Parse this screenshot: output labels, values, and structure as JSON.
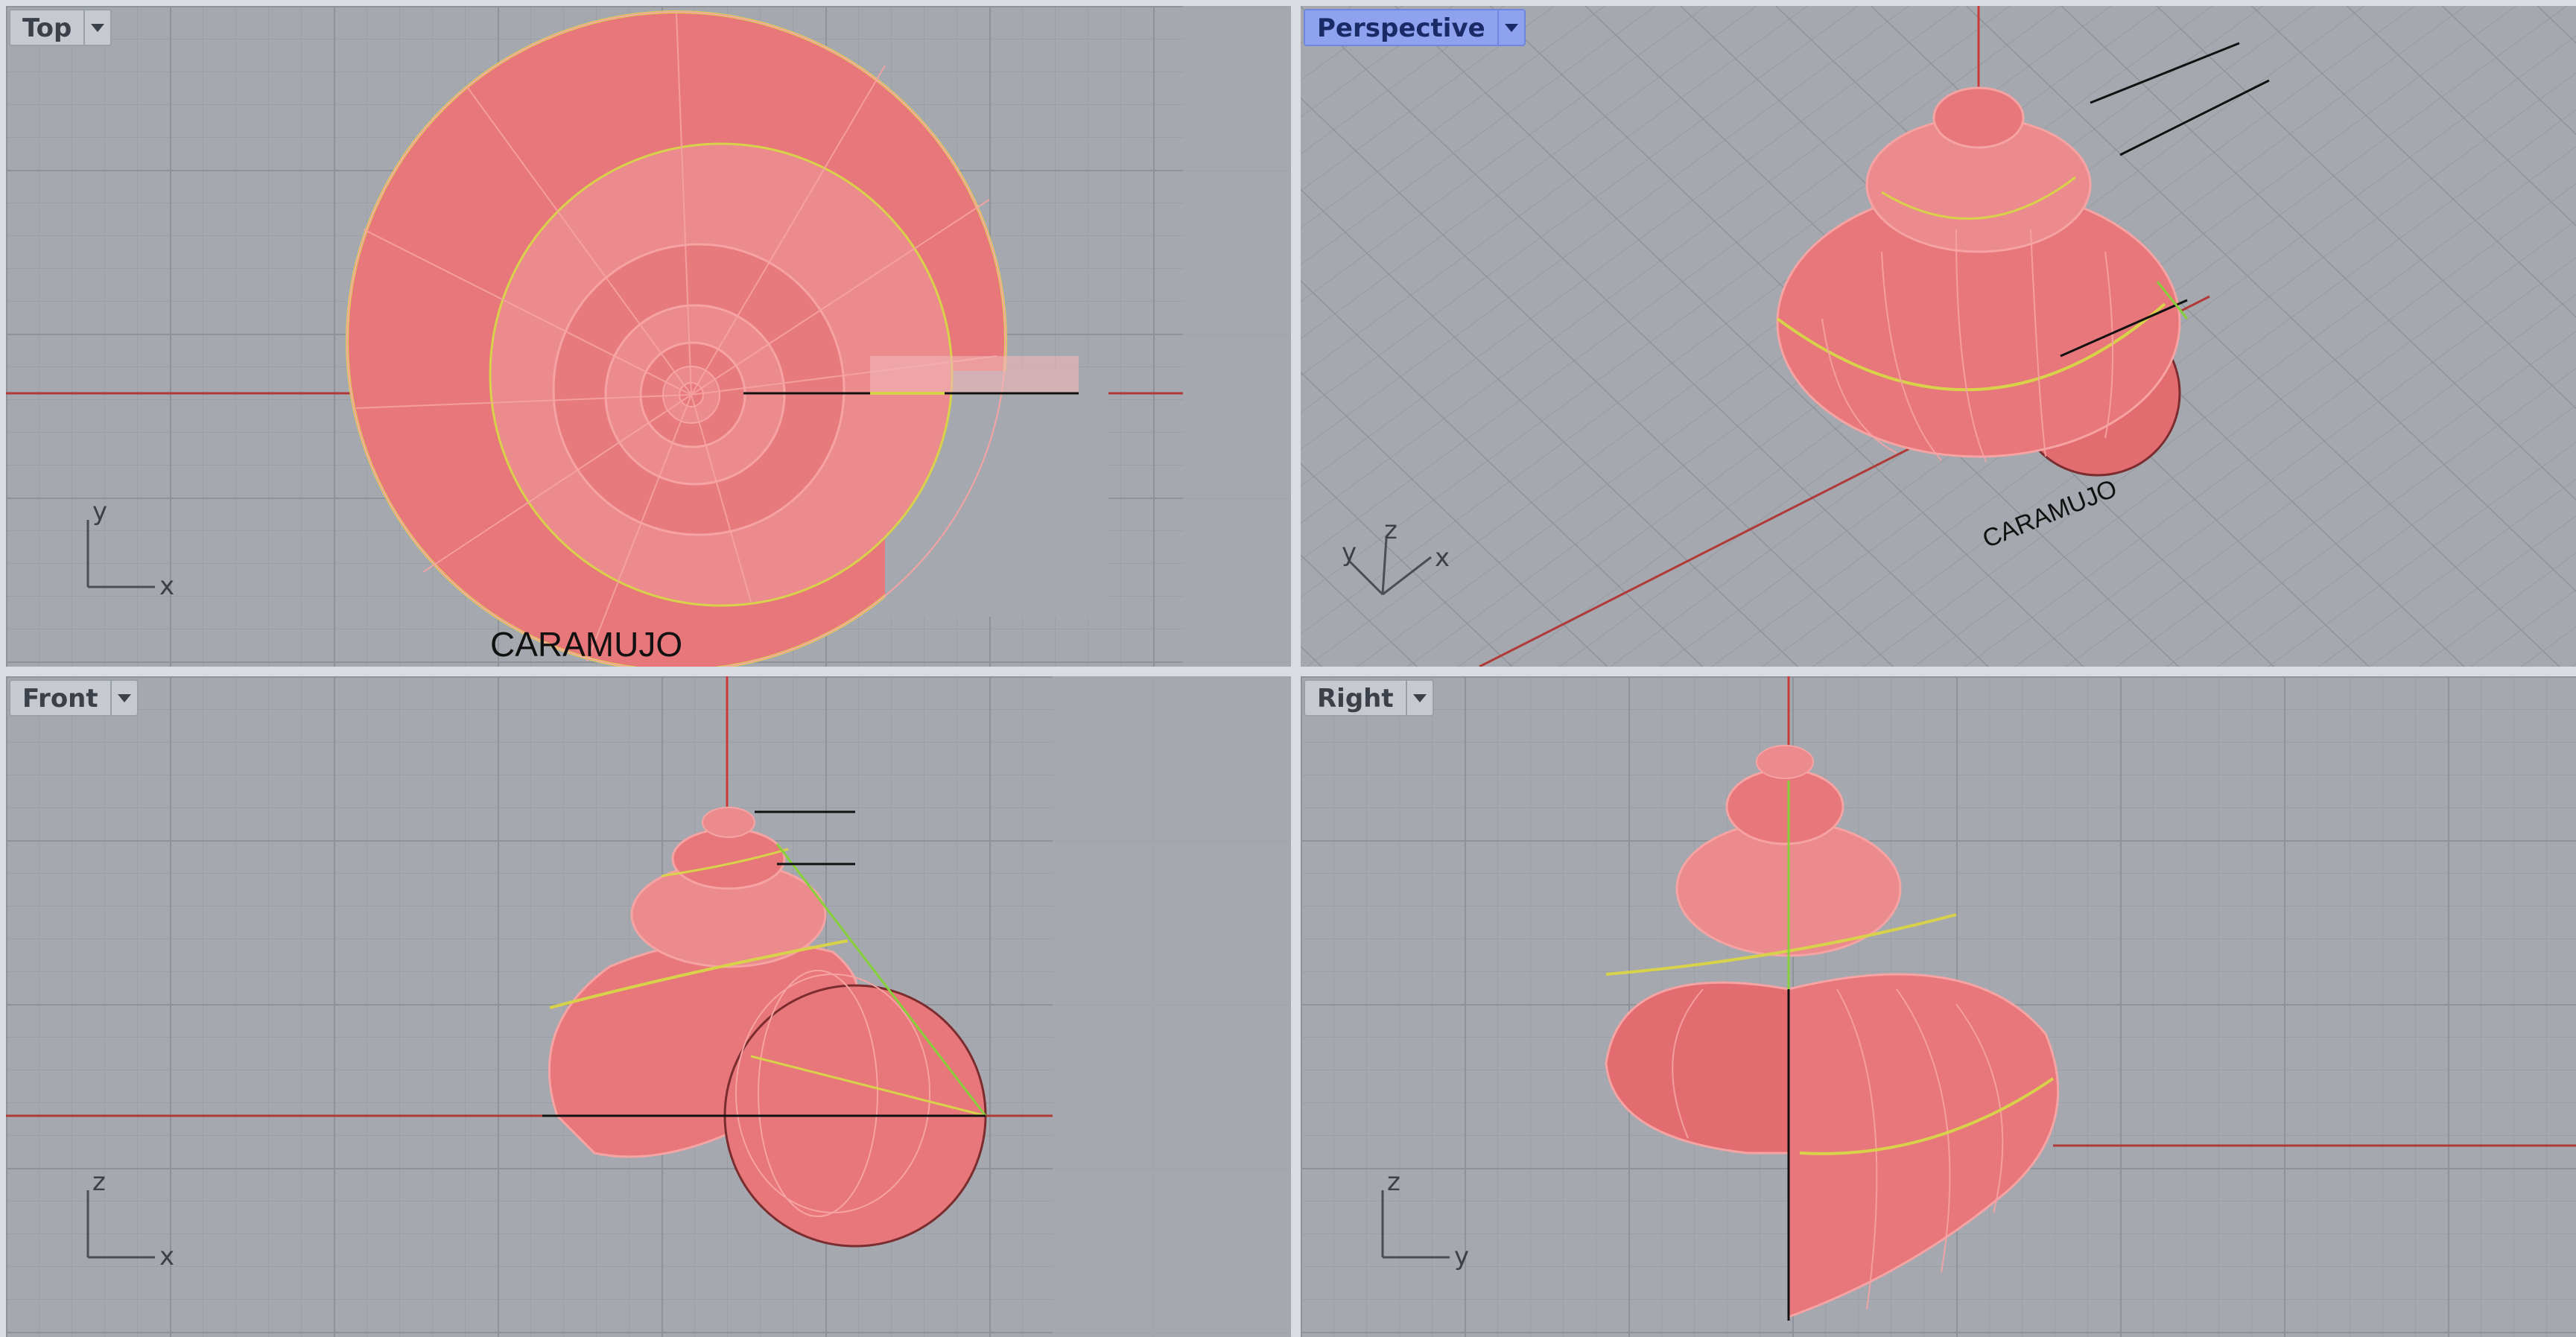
{
  "viewports": {
    "top": {
      "title": "Top",
      "active": false,
      "axes": [
        "y",
        "x"
      ],
      "label": "CARAMUJO"
    },
    "persp": {
      "title": "Perspective",
      "active": true,
      "axes": [
        "y",
        "z",
        "x"
      ],
      "label": "CARAMUJO"
    },
    "front": {
      "title": "Front",
      "active": false,
      "axes": [
        "z",
        "x"
      ]
    },
    "right": {
      "title": "Right",
      "active": false,
      "axes": [
        "z",
        "y"
      ]
    }
  },
  "colors": {
    "viewport_background": "#a5a9af",
    "grid_major": "#8e939a",
    "grid_minor": "#9ca0a6",
    "shell_fill": "#e7777a",
    "shell_isocurve": "#f6a3a4",
    "curve_yellow": "#d8d24a",
    "curve_green": "#86d13a",
    "x_axis": "#b03a38",
    "active_tab": "#8ea2f0"
  },
  "icons": {
    "viewport_menu": "dropdown-arrow-icon",
    "world_axes": "axes-gizmo-icon"
  }
}
